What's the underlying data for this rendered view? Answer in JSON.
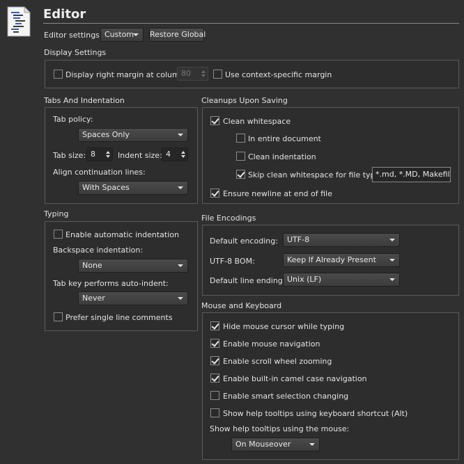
{
  "header": {
    "title": "Editor"
  },
  "editor_settings": {
    "label": "Editor settings:",
    "value": "Custom",
    "restore_label": "Restore Global"
  },
  "display": {
    "section": "Display Settings",
    "right_margin_label": "Display right margin at column:",
    "right_margin_value": "80",
    "right_margin_checked": false,
    "context_margin_label": "Use context-specific margin",
    "context_margin_checked": false
  },
  "tabs": {
    "section": "Tabs And Indentation",
    "policy_label": "Tab policy:",
    "policy_value": "Spaces Only",
    "tab_size_label": "Tab size:",
    "tab_size_value": "8",
    "indent_size_label": "Indent size:",
    "indent_size_value": "4",
    "align_label": "Align continuation lines:",
    "align_value": "With Spaces"
  },
  "typing": {
    "section": "Typing",
    "auto_indent_label": "Enable automatic indentation",
    "auto_indent_checked": false,
    "backspace_label": "Backspace indentation:",
    "backspace_value": "None",
    "tab_key_label": "Tab key performs auto-indent:",
    "tab_key_value": "Never",
    "single_line_label": "Prefer single line comments",
    "single_line_checked": false
  },
  "cleanups": {
    "section": "Cleanups Upon Saving",
    "clean_ws_label": "Clean whitespace",
    "clean_ws_checked": true,
    "entire_doc_label": "In entire document",
    "entire_doc_checked": false,
    "clean_indent_label": "Clean indentation",
    "clean_indent_checked": false,
    "skip_label": "Skip clean whitespace for file types:",
    "skip_checked": true,
    "skip_value": "*.md, *.MD, Makefile",
    "newline_label": "Ensure newline at end of file",
    "newline_checked": true
  },
  "encodings": {
    "section": "File Encodings",
    "default_label": "Default encoding:",
    "default_value": "UTF-8",
    "bom_label": "UTF-8 BOM:",
    "bom_value": "Keep If Already Present",
    "line_endings_label": "Default line endings:",
    "line_endings_value": "Unix (LF)"
  },
  "mouse": {
    "section": "Mouse and Keyboard",
    "hide_cursor_label": "Hide mouse cursor while typing",
    "hide_cursor_checked": true,
    "mouse_nav_label": "Enable mouse navigation",
    "mouse_nav_checked": true,
    "scroll_zoom_label": "Enable scroll wheel zooming",
    "scroll_zoom_checked": true,
    "camel_label": "Enable built-in camel case navigation",
    "camel_checked": true,
    "smart_sel_label": "Enable smart selection changing",
    "smart_sel_checked": false,
    "tooltips_kb_label": "Show help tooltips using keyboard shortcut (Alt)",
    "tooltips_kb_checked": false,
    "tooltips_mouse_label": "Show help tooltips using the mouse:",
    "tooltips_mouse_value": "On Mouseover"
  }
}
